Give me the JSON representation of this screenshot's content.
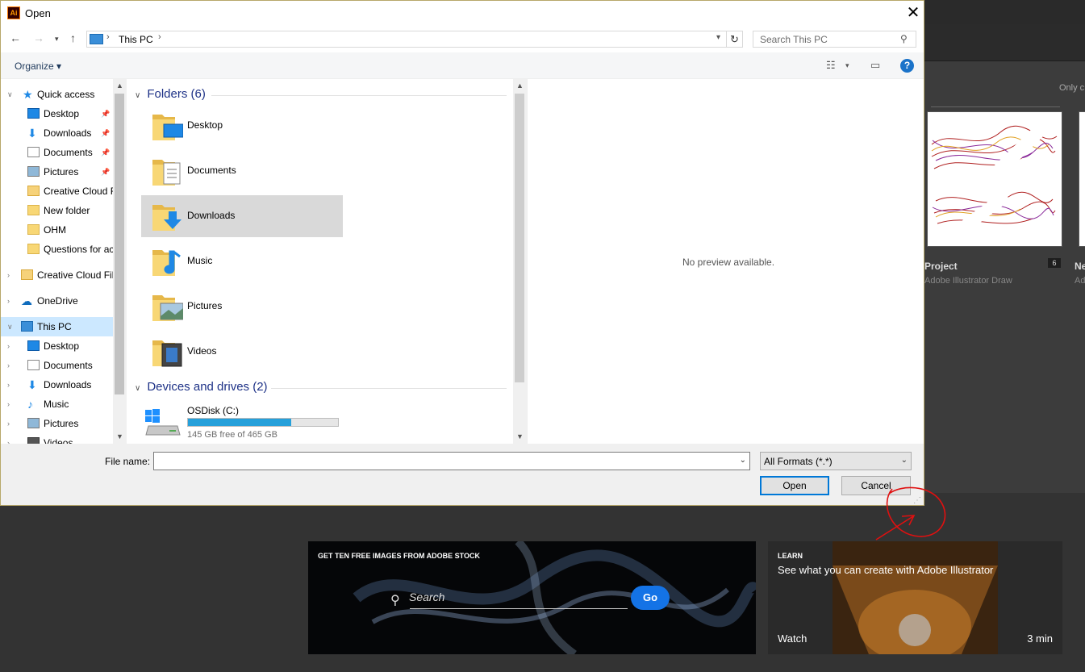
{
  "dialog": {
    "title": "Open",
    "app_icon_text": "Ai",
    "address": {
      "crumb": "This PC"
    },
    "search_placeholder": "Search This PC",
    "organize_label": "Organize ▾"
  },
  "nav": {
    "items": [
      {
        "label": "Quick access",
        "icon": "star-icon"
      },
      {
        "label": "Desktop",
        "icon": "desktop-icon",
        "pinned": true
      },
      {
        "label": "Downloads",
        "icon": "download-icon",
        "pinned": true
      },
      {
        "label": "Documents",
        "icon": "document-icon",
        "pinned": true
      },
      {
        "label": "Pictures",
        "icon": "pictures-icon",
        "pinned": true
      },
      {
        "label": "Creative Cloud F",
        "icon": "creative-cloud-folder-icon"
      },
      {
        "label": "New folder",
        "icon": "folder-icon"
      },
      {
        "label": "OHM",
        "icon": "folder-icon"
      },
      {
        "label": "Questions for ac",
        "icon": "folder-icon"
      },
      {
        "label": "Creative Cloud Fil",
        "icon": "creative-cloud-folder-icon"
      },
      {
        "label": "OneDrive",
        "icon": "onedrive-icon"
      },
      {
        "label": "This PC",
        "icon": "computer-icon"
      },
      {
        "label": "Desktop",
        "icon": "desktop-icon"
      },
      {
        "label": "Documents",
        "icon": "document-icon"
      },
      {
        "label": "Downloads",
        "icon": "download-icon"
      },
      {
        "label": "Music",
        "icon": "music-icon"
      },
      {
        "label": "Pictures",
        "icon": "pictures-icon"
      },
      {
        "label": "Videos",
        "icon": "video-icon"
      }
    ]
  },
  "content": {
    "folders_header": "Folders (6)",
    "folders": [
      {
        "label": "Desktop",
        "icon": "desktop-folder-icon"
      },
      {
        "label": "Documents",
        "icon": "documents-folder-icon"
      },
      {
        "label": "Downloads",
        "icon": "downloads-folder-icon",
        "selected": true
      },
      {
        "label": "Music",
        "icon": "music-folder-icon"
      },
      {
        "label": "Pictures",
        "icon": "pictures-folder-icon"
      },
      {
        "label": "Videos",
        "icon": "videos-folder-icon"
      }
    ],
    "drives_header": "Devices and drives (2)",
    "drive": {
      "name": "OSDisk (C:)",
      "free_text": "145 GB free of 465 GB",
      "used_fraction": 0.69
    }
  },
  "preview_text": "No preview available.",
  "bottom": {
    "filename_label": "File name:",
    "filename_value": "",
    "format_value": "All Formats (*.*)",
    "open_label": "Open",
    "cancel_label": "Cancel"
  },
  "background": {
    "only_label": "Only c",
    "card_title": "Project",
    "card_sub": "Adobe Illustrator Draw",
    "card_badge": "6",
    "card2_title": "Ne",
    "card2_sub": "Ad",
    "stock": {
      "heading": "GET TEN FREE IMAGES FROM ADOBE STOCK",
      "search_placeholder": "Search",
      "go_label": "Go"
    },
    "learn": {
      "heading": "LEARN",
      "title": "See what you can create with Adobe Illustrator",
      "watch_label": "Watch",
      "duration": "3 min"
    }
  },
  "colors": {
    "accent": "#1473e6",
    "selection": "#cce8ff",
    "drive_bar": "#26a0da",
    "annotation": "#e01010"
  }
}
